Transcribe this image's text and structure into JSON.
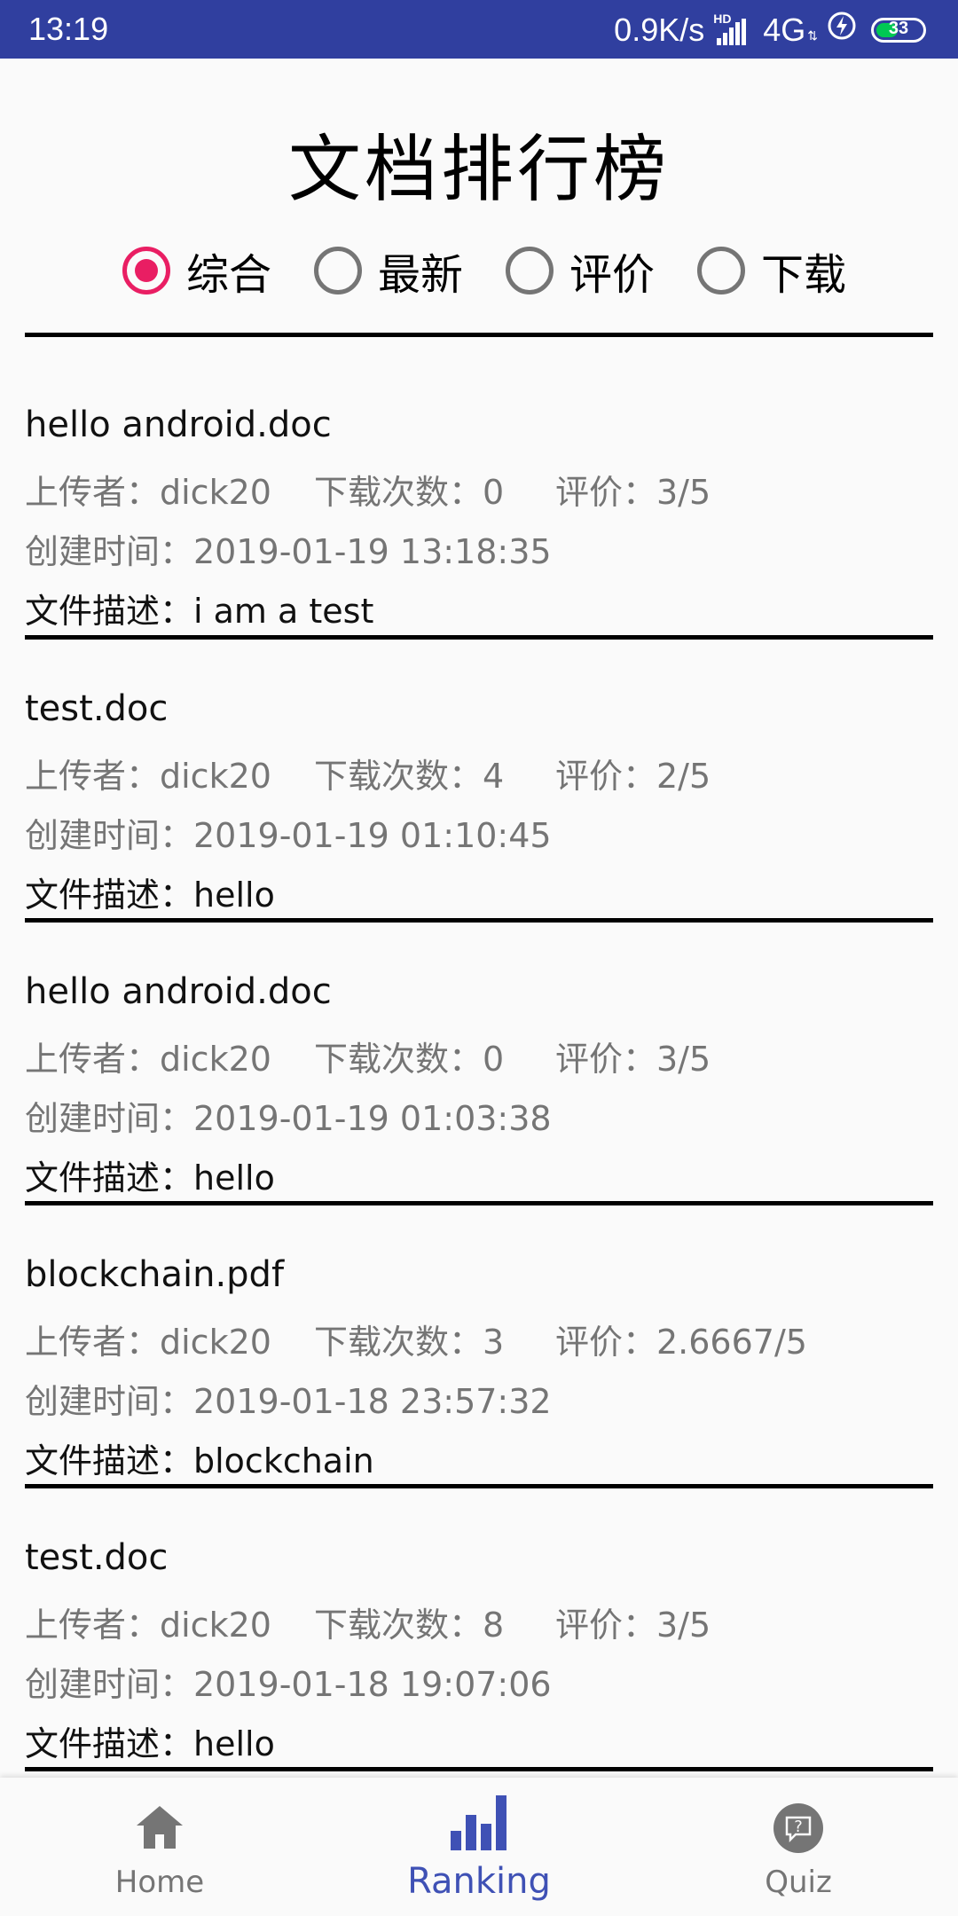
{
  "status_bar": {
    "time": "13:19",
    "speed": "0.9K/s",
    "hd": "HD",
    "network": "4G",
    "battery": "33"
  },
  "title": "文档排行榜",
  "sort_options": [
    {
      "label": "综合",
      "checked": true
    },
    {
      "label": "最新",
      "checked": false
    },
    {
      "label": "评价",
      "checked": false
    },
    {
      "label": "下载",
      "checked": false
    }
  ],
  "documents": [
    {
      "name": "hello android.doc",
      "uploader": "上传者：dick20",
      "downloads": "下载次数：0",
      "rating": "评价：3/5",
      "created": "创建时间：2019-01-19 13:18:35",
      "description": "文件描述：i am a test"
    },
    {
      "name": "test.doc",
      "uploader": "上传者：dick20",
      "downloads": "下载次数：4",
      "rating": "评价：2/5",
      "created": "创建时间：2019-01-19 01:10:45",
      "description": "文件描述：hello"
    },
    {
      "name": "hello android.doc",
      "uploader": "上传者：dick20",
      "downloads": "下载次数：0",
      "rating": "评价：3/5",
      "created": "创建时间：2019-01-19 01:03:38",
      "description": "文件描述：hello"
    },
    {
      "name": "blockchain.pdf",
      "uploader": "上传者：dick20",
      "downloads": "下载次数：3",
      "rating": "评价：2.6667/5",
      "created": "创建时间：2019-01-18 23:57:32",
      "description": "文件描述：blockchain"
    },
    {
      "name": "test.doc",
      "uploader": "上传者：dick20",
      "downloads": "下载次数：8",
      "rating": "评价：3/5",
      "created": "创建时间：2019-01-18 19:07:06",
      "description": "文件描述：hello"
    }
  ],
  "bottom_nav": [
    {
      "label": "Home",
      "icon": "home-icon",
      "active": false
    },
    {
      "label": "Ranking",
      "icon": "ranking-bars-icon",
      "active": true
    },
    {
      "label": "Quiz",
      "icon": "quiz-help-icon",
      "active": false
    }
  ],
  "colors": {
    "status_bar": "#303f9f",
    "accent_radio": "#e91e63",
    "active_nav": "#3f51b5",
    "inactive_nav": "#757575"
  }
}
